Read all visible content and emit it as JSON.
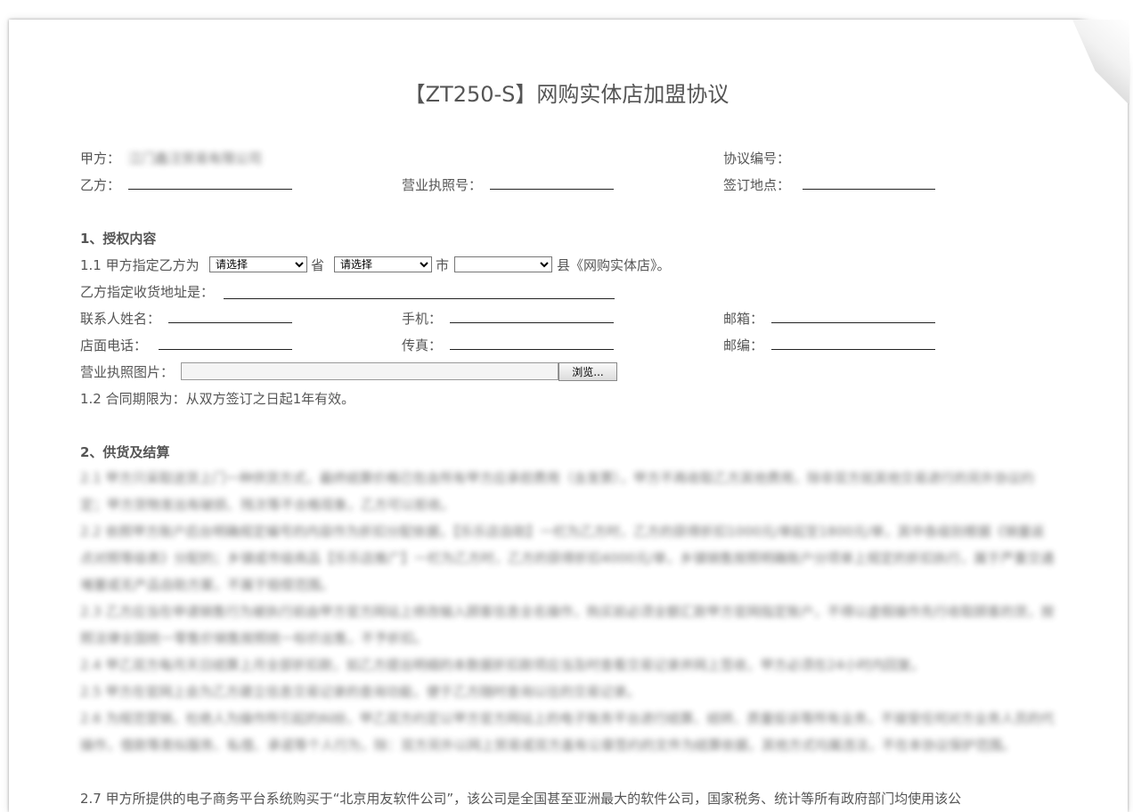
{
  "title": "【ZT250-S】网购实体店加盟协议",
  "header": {
    "party_a_label": "甲方：",
    "party_a_value": "江门鑫汪贸易有限公司",
    "agreement_no_label": "协议编号：",
    "party_b_label": "乙方：",
    "license_no_label": "营业执照号：",
    "sign_place_label": "签订地点："
  },
  "section1": {
    "heading": "1、授权内容",
    "clause_prefix": "1.1 甲方指定乙方为",
    "province_select": "请选择",
    "province_suffix": "省",
    "city_select": "请选择",
    "city_suffix": "市",
    "county_select": "",
    "county_suffix": "县《网购实体店》。",
    "address_label": "乙方指定收货地址是：",
    "contact_label": "联系人姓名：",
    "mobile_label": "手机：",
    "email_label": "邮箱：",
    "phone_label": "店面电话：",
    "fax_label": "传真：",
    "zip_label": "邮编：",
    "license_image_label": "营业执照图片：",
    "browse_label": "浏览...",
    "term": "1.2 合同期限为：从双方签订之日起1年有效。"
  },
  "section2": {
    "heading": "2、供货及结算",
    "paragraphs": [
      "2.1 甲方只采取送货上门一种供货方式，最终结算价格已包含所有甲方应承担费用（含发票），甲方不再收取乙方其他费用，除非双方就其他交易进行的另外协议约定；甲方货物发出有破损、残次等不合格现象，乙方可以拒收。",
      "2.2 依照甲方账户后台明确规定编号的内容作为折扣分配依据，【乐乐店自助】一栏为乙方时，乙方的获得折扣1000元/单起至1800元/单，其中各级别根据《销量返点对照等级表》分配的；乡镇或市级商品【乐乐店推广】一栏为乙方时，乙方的获得折扣4000元/单，乡镇销售按照明确账户分项单上规定的折扣执行，属于严重交通堵塞或无产品自助方案，不属于赔偿范围。",
      "2.3 乙方应当在申请销售行为被执行前由甲方官方网站上修改输入顾客信息全名操作，购买前必须全额汇款甲方官网指定账户，不得以虚假操作先行收取顾客的货，按照法律全国统一零售价销售按照统一标价出售，不予折扣。",
      "2.4 甲乙双方每月天日结算上月全部折扣款，如乙方提出明细的本数据折扣款项应当及时查看交易记录并网上签收，甲方必须在24小时内回复。",
      "2.5 甲方在官网上会为乙方建立信息交易记录的查询功能，便于乙方随时查询以往的交易记录。",
      "2.6 为规范营销，杜绝人为操作所引起的纠纷，甲乙双方约定以甲方官方网站上的电子账务平台进行结算、结转、质量投诉等所有业务，不接受任何对方业务人员的代操作，借款等类似服务、私借、承诺等个人行为，除：双方另外以网上贸易或双方盖有公章签约的文件为结算依据，其他方式均属违法，不在本协议保护范围。",
      "2.7 甲方所提供的电子商务平台系统购买于“北京用友软件公司”，该公司是全国甚至亚洲最大的软件公司，国家税务、统计等所有政府部门均使用该公"
    ]
  }
}
